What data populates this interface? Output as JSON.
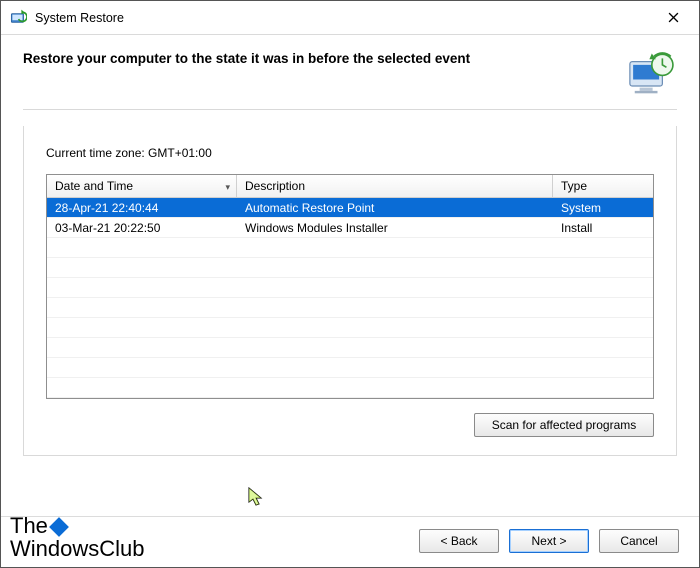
{
  "window": {
    "title": "System Restore"
  },
  "heading": "Restore your computer to the state it was in before the selected event",
  "timezone_label": "Current time zone: GMT+01:00",
  "table": {
    "columns": {
      "date": "Date and Time",
      "desc": "Description",
      "type": "Type"
    },
    "rows": [
      {
        "date": "28-Apr-21 22:40:44",
        "desc": "Automatic Restore Point",
        "type": "System",
        "selected": true
      },
      {
        "date": "03-Mar-21 20:22:50",
        "desc": "Windows Modules Installer",
        "type": "Install",
        "selected": false
      }
    ]
  },
  "buttons": {
    "scan": "Scan for affected programs",
    "back": "< Back",
    "next": "Next >",
    "cancel": "Cancel"
  },
  "watermark": {
    "line1": "The",
    "line2": "WindowsClub"
  }
}
